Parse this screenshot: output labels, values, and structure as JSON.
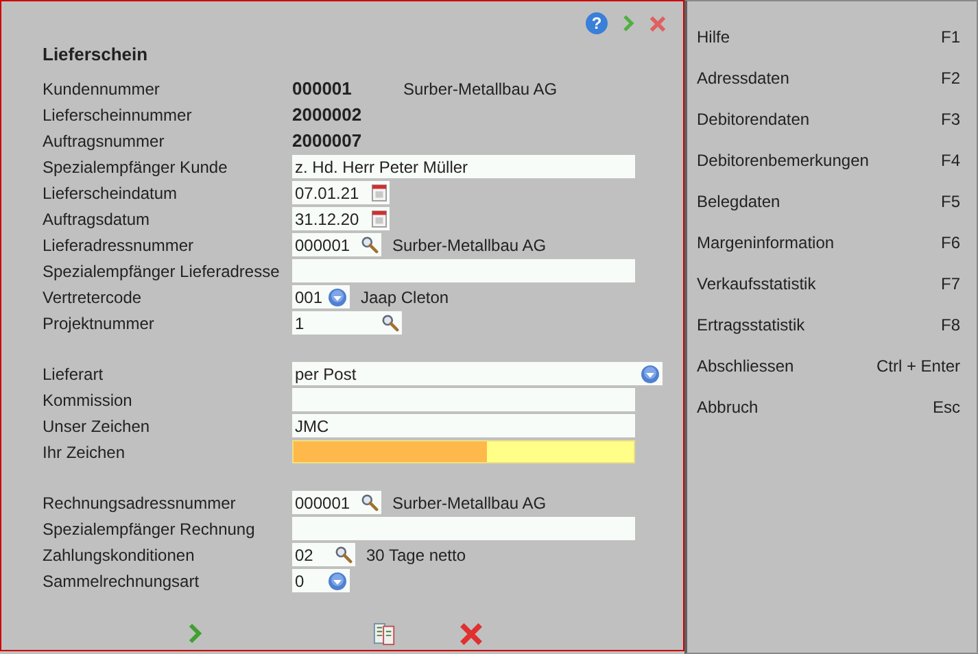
{
  "toolbar": {
    "help": "?"
  },
  "title": "Lieferschein",
  "sections": [
    {
      "rows": [
        {
          "label": "Kundennummer",
          "kind": "bold",
          "value": "000001",
          "extra": "Surber-Metallbau AG"
        },
        {
          "label": "Lieferscheinnummer",
          "kind": "bold",
          "value": "2000002"
        },
        {
          "label": "Auftragsnummer",
          "kind": "bold",
          "value": "2000007"
        },
        {
          "label": "Spezialempfänger Kunde",
          "kind": "text",
          "value": "z. Hd. Herr Peter Müller"
        },
        {
          "label": "Lieferscheindatum",
          "kind": "date",
          "value": "07.01.21"
        },
        {
          "label": "Auftragsdatum",
          "kind": "date",
          "value": "31.12.20"
        },
        {
          "label": "Lieferadressnummer",
          "kind": "lookup",
          "value": "000001",
          "extra": "Surber-Metallbau AG"
        },
        {
          "label": "Spezialempfänger Lieferadresse",
          "kind": "text"
        },
        {
          "label": "Vertretercode",
          "kind": "dropdown",
          "value": "001",
          "extra": "Jaap Cleton"
        },
        {
          "label": "Projektnummer",
          "kind": "lookup",
          "value": "1"
        }
      ]
    },
    {
      "rows": [
        {
          "label": "Lieferart",
          "kind": "select",
          "value": "per Post"
        },
        {
          "label": "Kommission",
          "kind": "text"
        },
        {
          "label": "Unser Zeichen",
          "kind": "text",
          "value": "JMC"
        },
        {
          "label": "Ihr Zeichen",
          "kind": "meter",
          "level": 0.57
        }
      ]
    },
    {
      "rows": [
        {
          "label": "Rechnungsadressnummer",
          "kind": "lookup",
          "value": "000001",
          "extra": "Surber-Metallbau AG"
        },
        {
          "label": "Spezialempfänger Rechnung",
          "kind": "text"
        },
        {
          "label": "Zahlungskonditionen",
          "kind": "lookup",
          "value": "02",
          "extra": "30 Tage netto"
        },
        {
          "label": "Sammelrechnungsart",
          "kind": "dropdown",
          "value": "0"
        }
      ]
    }
  ],
  "menu": [
    {
      "label": "Hilfe",
      "shortcut": "F1"
    },
    {
      "label": "Adressdaten",
      "shortcut": "F2"
    },
    {
      "label": "Debitorendaten",
      "shortcut": "F3"
    },
    {
      "label": "Debitorenbemerkungen",
      "shortcut": "F4"
    },
    {
      "label": "Belegdaten",
      "shortcut": "F5"
    },
    {
      "label": "Margeninformation",
      "shortcut": "F6"
    },
    {
      "label": "Verkaufsstatistik",
      "shortcut": "F7"
    },
    {
      "label": "Ertragsstatistik",
      "shortcut": "F8"
    },
    {
      "label": "Abschliessen",
      "shortcut": "Ctrl + Enter"
    },
    {
      "label": "Abbruch",
      "shortcut": "Esc"
    }
  ]
}
